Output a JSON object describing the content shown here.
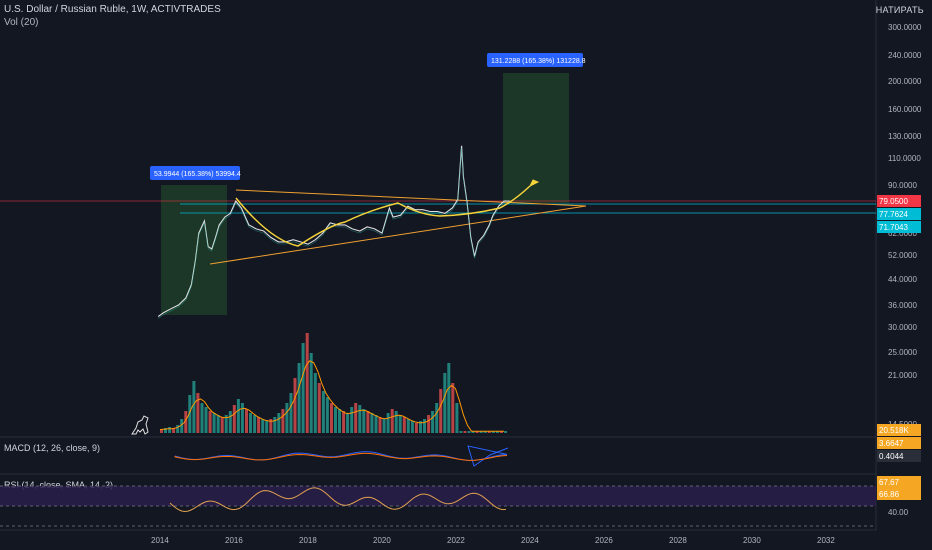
{
  "header": {
    "symbol_line": "U.S. Dollar / Russian Ruble, 1W, ACTIVTRADES",
    "volume_label": "Vol (20)"
  },
  "price_axis_title": "НАТИРАТЬ",
  "macd_label": "MACD (12, 26, close, 9)",
  "rsi_label": "RSI (14, close, SMA, 14, 2)",
  "colors": {
    "background": "#131722",
    "candle_line": "#e0e0e0",
    "accent_yellow": "#f5d33b",
    "trend_orange": "#f0a030",
    "measure_fill": "#1e3a28",
    "label_blue": "#2962ff",
    "level_cyan": "#00bcd4",
    "price_red": "#f23645",
    "rsi_band": "#2a1f4a",
    "vol_green": "#26a69a",
    "vol_red": "#ef5350",
    "vol_ma": "#ff9800"
  },
  "chart_data": {
    "type": "line",
    "title": "U.S. Dollar / Russian Ruble, 1W, ACTIVTRADES",
    "y_scale": "log",
    "x_ticks": [
      "2014",
      "2016",
      "2018",
      "2020",
      "2022",
      "2024",
      "2026",
      "2028",
      "2030",
      "2032"
    ],
    "y_ticks": [
      "300.0000",
      "240.0000",
      "200.0000",
      "160.0000",
      "130.0000",
      "110.0000",
      "90.0000",
      "62.0000",
      "52.0000",
      "44.0000",
      "36.0000",
      "30.0000",
      "25.0000",
      "21.0000",
      "14.5000"
    ],
    "price_tags": [
      {
        "text": "79.0500",
        "color": "#f23645"
      },
      {
        "text": "77.7624",
        "color": "#00bcd4"
      },
      {
        "text": "71.7043",
        "color": "#00bcd4"
      },
      {
        "text": "20.518K",
        "color": "#f5a623"
      },
      {
        "text": "3.6647",
        "color": "#f5a623"
      },
      {
        "text": "0.4044",
        "color": "#2a2e39"
      },
      {
        "text": "67.67",
        "color": "#f5a623"
      },
      {
        "text": "66.86",
        "color": "#f5a623"
      }
    ],
    "rsi_ticks": [
      "40.00"
    ],
    "measure_labels": [
      "53.9944 (165.38%) 53994.4",
      "131.2288 (165.38%) 131228.8"
    ],
    "series": [
      {
        "x": [
          2013.95,
          2014.1,
          2014.3,
          2014.5,
          2014.7,
          2014.85,
          2014.95,
          2015.05,
          2015.2,
          2015.3,
          2015.4,
          2015.5,
          2015.6,
          2015.75,
          2015.9,
          2016.05,
          2016.2,
          2016.4,
          2016.6,
          2016.8,
          2017.0,
          2017.2,
          2017.4,
          2017.6,
          2017.8,
          2018.0,
          2018.2,
          2018.4,
          2018.6,
          2018.8,
          2019.0,
          2019.2,
          2019.4,
          2019.6,
          2019.8,
          2020.0,
          2020.2,
          2020.3,
          2020.5,
          2020.7,
          2020.9,
          2021.1,
          2021.3,
          2021.5,
          2021.7,
          2021.9,
          2022.05,
          2022.15,
          2022.2,
          2022.3,
          2022.4,
          2022.5,
          2022.6,
          2022.75,
          2022.9,
          2023.0,
          2023.15,
          2023.3,
          2023.45
        ],
        "values": [
          33,
          34,
          35,
          36,
          38,
          42,
          50,
          62,
          68,
          56,
          55,
          60,
          66,
          70,
          72,
          79,
          75,
          66,
          64,
          63,
          60,
          58,
          58,
          59,
          58,
          57,
          59,
          62,
          67,
          66,
          66,
          64,
          63,
          65,
          64,
          62,
          75,
          70,
          71,
          76,
          74,
          74,
          73,
          73,
          72,
          75,
          80,
          120,
          95,
          78,
          60,
          52,
          58,
          61,
          66,
          71,
          76,
          79,
          79
        ]
      }
    ]
  }
}
